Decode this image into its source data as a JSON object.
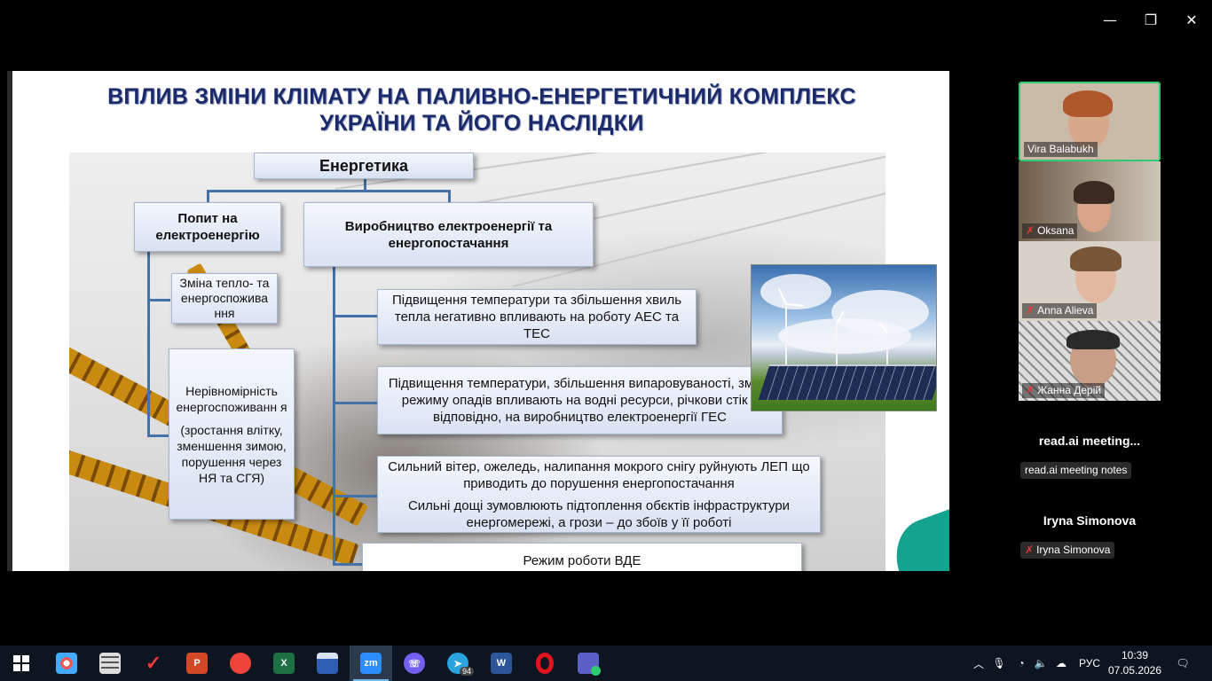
{
  "window_controls": {
    "minimize": "—",
    "restore": "❐",
    "close": "✕"
  },
  "slide": {
    "title_line1": "ВПЛИВ ЗМІНИ КЛІМАТУ НА ПАЛИВНО-ЕНЕРГЕТИЧНИЙ КОМПЛЕКС",
    "title_line2": "УКРАЇНИ ТА ЙОГО НАСЛІДКИ",
    "root": "Енергетика",
    "left_branch": {
      "heading": "Попит на електроенергію",
      "item1": "Зміна тепло- та енергоспожива ння",
      "item2_line1": "Нерівномірність енергоспоживанн я",
      "item2_line2": "(зростання влітку, зменшення зимою, порушення через НЯ та СГЯ)"
    },
    "right_branch": {
      "heading": "Виробництво електроенергії та енергопостачання",
      "item1": "Підвищення температури та збільшення хвиль тепла негативно впливають на роботу АЕС та ТЕС",
      "item2": "Підвищення температури, збільшення випаровуваності, зміна режиму опадів впливають на водні ресурси, річкови стік і, відповідно, на виробництво електроенергії ГЕС",
      "item3_line1": "Сильний вітер, ожеледь, налипання мокрого снігу руйнують ЛЕП що приводить до порушення енергопостачання",
      "item3_line2": "Сильні дощі  зумовлюють підтоплення обєктів інфраструктури енергомережі, а грози – до збоїв у її роботі",
      "item4": "Режим роботи ВДЕ"
    }
  },
  "participants": [
    {
      "name": "Vira Balabukh",
      "muted": false,
      "active_speaker": true
    },
    {
      "name": "Oksana",
      "muted": true
    },
    {
      "name": "Anna Alieva",
      "muted": true
    },
    {
      "name": "Жанна Дерій",
      "muted": true
    }
  ],
  "extra_participants": [
    {
      "display": "read.ai  meeting...",
      "chip": "read.ai meeting notes",
      "muted": false
    },
    {
      "display": "Iryna Simonova",
      "chip": "Iryna Simonova",
      "muted": true
    }
  ],
  "taskbar": {
    "apps": [
      "start-icon",
      "paint-icon",
      "calculator-icon",
      "vivaldi-icon",
      "powerpoint-icon",
      "anydesk-icon",
      "excel-icon",
      "save-icon",
      "zoom-icon",
      "viber-icon",
      "telegram-icon",
      "word-icon",
      "opera-icon",
      "teams-icon"
    ],
    "telegram_badge": "94",
    "zoom_label": "zm",
    "powerpoint_label": "P",
    "excel_label": "X",
    "word_label": "W",
    "language": "РУС",
    "time": "10:39",
    "date": "07.05.2026"
  }
}
